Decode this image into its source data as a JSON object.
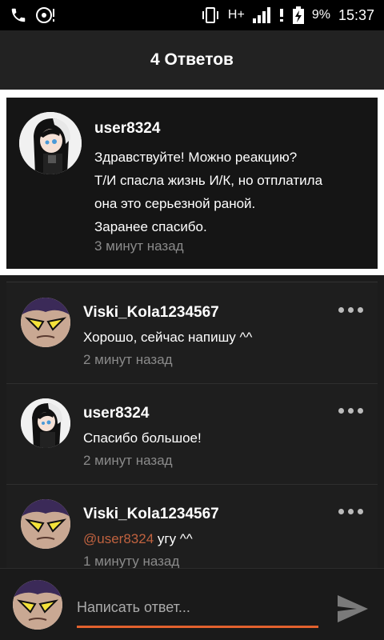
{
  "status_bar": {
    "network": "H+",
    "battery": "9%",
    "time": "15:37"
  },
  "header": {
    "title": "4 Ответов"
  },
  "original_post": {
    "username": "user8324",
    "text_lines": [
      "Здравствуйте! Можно реакцию?",
      "Т/И спасла жизнь И/К, но  отплатила",
      "она это серьезной раной.",
      "Заранее спасибо."
    ],
    "time": "3 минут назад"
  },
  "replies": [
    {
      "username": "Viski_Kola1234567",
      "mention": "",
      "text": "Хорошо, сейчас напишу ^^",
      "time": "2 минут назад"
    },
    {
      "username": "user8324",
      "mention": "",
      "text": "Спасибо большое!",
      "time": "2 минут назад"
    },
    {
      "username": "Viski_Kola1234567",
      "mention": "@user8324",
      "text": " угу ^^",
      "time": "1 минуту назад"
    }
  ],
  "compose": {
    "placeholder": "Написать ответ..."
  },
  "colors": {
    "accent": "#e2612e",
    "mention": "#c0623f",
    "background": "#1c1c1c"
  }
}
